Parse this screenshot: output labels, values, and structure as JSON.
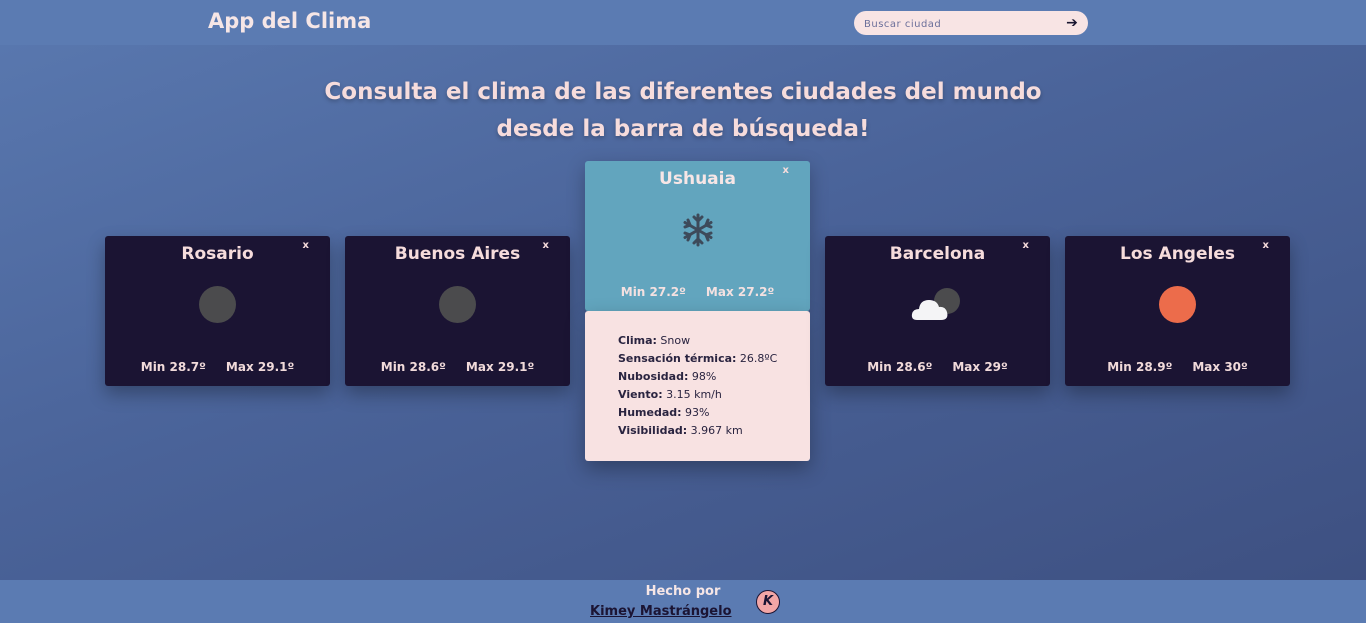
{
  "header": {
    "title": "App del Clima",
    "search_placeholder": "Buscar ciudad",
    "search_button_icon": "arrow-right-icon"
  },
  "headline": {
    "line1": "Consulta el clima de las diferentes ciudades del mundo",
    "line2": "desde la barra de búsqueda!"
  },
  "cards": [
    {
      "city": "Rosario",
      "icon": "moon-icon",
      "min": "Min 28.7º",
      "max": "Max 29.1º",
      "close": "x"
    },
    {
      "city": "Buenos Aires",
      "icon": "moon-icon",
      "min": "Min 28.6º",
      "max": "Max 29.1º",
      "close": "x"
    },
    {
      "city": "Ushuaia",
      "icon": "snowflake-icon",
      "min": "Min 27.2º",
      "max": "Max 27.2º",
      "close": "x",
      "active": true
    },
    {
      "city": "Barcelona",
      "icon": "cloud-moon-icon",
      "min": "Min 28.6º",
      "max": "Max 29º",
      "close": "x"
    },
    {
      "city": "Los Angeles",
      "icon": "sun-icon",
      "min": "Min 28.9º",
      "max": "Max 30º",
      "close": "x"
    }
  ],
  "detail": {
    "clima_label": "Clima:",
    "clima_value": "Snow",
    "sensacion_label": "Sensación térmica:",
    "sensacion_value": "26.8ºC",
    "nubosidad_label": "Nubosidad:",
    "nubosidad_value": "98%",
    "viento_label": "Viento:",
    "viento_value": "3.15 km/h",
    "humedad_label": "Humedad:",
    "humedad_value": "93%",
    "visibilidad_label": "Visibilidad:",
    "visibilidad_value": "3.967 km"
  },
  "footer": {
    "label": "Hecho por",
    "author": "Kimey Mastrángelo",
    "logo_letter": "K"
  },
  "colors": {
    "header_bg": "#5b7bb2",
    "card_bg": "#1b1433",
    "active_card_bg": "#62a5be",
    "detail_bg": "#f8e2e2",
    "sun": "#ec6c4b",
    "moon": "#4b4b4d"
  }
}
